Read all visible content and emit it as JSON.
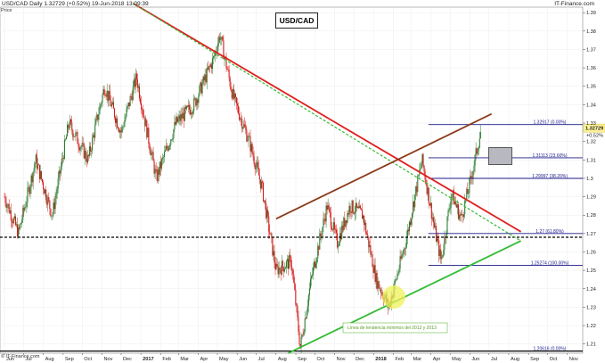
{
  "header": {
    "symbol": "USD/CAD",
    "timeframe": "Daily",
    "last": "1.32729",
    "change": "(+0.52%)",
    "datetime": "19-Jun-2018 13:09:39",
    "source": "IT-Finance.com",
    "price_label": "Price"
  },
  "footer": {
    "source": "© IT-Finance.com"
  },
  "colors": {
    "bull": "#2e7d32",
    "bear": "#d81b1b",
    "resistance": "#e02020",
    "channel": "#8b3a1a",
    "support": "#33bb33",
    "fibo": "#1a1a8a",
    "price_tag": "#fff59d"
  },
  "chart_data": {
    "type": "candlestick",
    "title": "USD/CAD",
    "ylim": [
      1.205,
      1.393
    ],
    "yticks": [
      "1.21",
      "1.22",
      "1.23",
      "1.24",
      "1.25",
      "1.26",
      "1.27",
      "1.28",
      "1.29",
      "1.3",
      "1.31",
      "1.32",
      "1.33",
      "1.34",
      "1.35",
      "1.36",
      "1.37",
      "1.38",
      "1.39"
    ],
    "xticks": [
      "Jun",
      "Jul",
      "Aug",
      "Sep",
      "Oct",
      "Nov",
      "Dec",
      "2017",
      "Feb",
      "Mar",
      "Apr",
      "May",
      "Jun",
      "Jul",
      "Aug",
      "Sep",
      "Oct",
      "Nov",
      "Dec",
      "2018",
      "Feb",
      "Mar",
      "Apr",
      "May",
      "Jun",
      "Jul",
      "Aug",
      "Sep",
      "Oct",
      "Nov"
    ],
    "price_path": [
      [
        "2016-06-01",
        1.29
      ],
      [
        "2016-06-23",
        1.27
      ],
      [
        "2016-07-20",
        1.31
      ],
      [
        "2016-08-15",
        1.28
      ],
      [
        "2016-09-10",
        1.33
      ],
      [
        "2016-10-10",
        1.31
      ],
      [
        "2016-11-05",
        1.35
      ],
      [
        "2016-12-01",
        1.325
      ],
      [
        "2016-12-25",
        1.355
      ],
      [
        "2017-01-25",
        1.3
      ],
      [
        "2017-02-25",
        1.33
      ],
      [
        "2017-03-25",
        1.34
      ],
      [
        "2017-04-25",
        1.365
      ],
      [
        "2017-05-05",
        1.378
      ],
      [
        "2017-05-25",
        1.345
      ],
      [
        "2017-06-20",
        1.32
      ],
      [
        "2017-07-10",
        1.295
      ],
      [
        "2017-08-01",
        1.25
      ],
      [
        "2017-08-25",
        1.255
      ],
      [
        "2017-09-08",
        1.208
      ],
      [
        "2017-09-25",
        1.245
      ],
      [
        "2017-10-20",
        1.285
      ],
      [
        "2017-11-05",
        1.265
      ],
      [
        "2017-11-25",
        1.285
      ],
      [
        "2017-12-15",
        1.28
      ],
      [
        "2018-01-05",
        1.245
      ],
      [
        "2018-01-25",
        1.23
      ],
      [
        "2018-02-20",
        1.265
      ],
      [
        "2018-03-18",
        1.31
      ],
      [
        "2018-04-08",
        1.27
      ],
      [
        "2018-04-17",
        1.255
      ],
      [
        "2018-05-03",
        1.292
      ],
      [
        "2018-05-18",
        1.278
      ],
      [
        "2018-06-01",
        1.297
      ],
      [
        "2018-06-19",
        1.327
      ]
    ],
    "last_price": 1.32729,
    "fibonacci": [
      {
        "label": "1.32917 (0.00%)",
        "value": 1.32917
      },
      {
        "label": "1.31113 (23.60%)",
        "value": 1.31113
      },
      {
        "label": "1.29997 (38.20%)",
        "value": 1.29997
      },
      {
        "label": "1.27 (61.80%)",
        "value": 1.27
      },
      {
        "label": "1.25274 (100.00%)",
        "value": 1.25274
      },
      {
        "label": "1.20616 (0.00%)",
        "value": 1.20616
      }
    ],
    "horizontal_support": 1.268,
    "trendlines": [
      {
        "name": "resistance-red",
        "from": [
          "2016-12-20",
          1.395
        ],
        "to": [
          "2018-08-20",
          1.271
        ]
      },
      {
        "name": "resistance-green-dashed",
        "from": [
          "2016-12-20",
          1.395
        ],
        "to": [
          "2018-08-20",
          1.266
        ]
      },
      {
        "name": "channel-top-brown",
        "from": [
          "2017-08-01",
          1.278
        ],
        "to": [
          "2018-07-05",
          1.335
        ]
      },
      {
        "name": "support-green",
        "from": [
          "2017-08-20",
          1.205
        ],
        "to": [
          "2018-08-20",
          1.266
        ]
      }
    ],
    "annotation": "Línea de tendencia mínimos del 2012 y 2013"
  }
}
